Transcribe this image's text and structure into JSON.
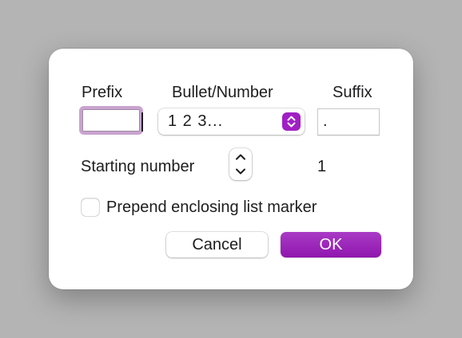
{
  "dialog": {
    "prefix": {
      "label": "Prefix",
      "value": ""
    },
    "bullet_number": {
      "label": "Bullet/Number",
      "selected": "1  2  3..."
    },
    "suffix": {
      "label": "Suffix",
      "value": "."
    },
    "starting_number": {
      "label": "Starting number",
      "value": "1"
    },
    "prepend_checkbox": {
      "label": "Prepend enclosing list marker",
      "checked": false
    },
    "buttons": {
      "cancel": "Cancel",
      "ok": "OK"
    }
  },
  "colors": {
    "accent": "#9b22c0",
    "focus_ring": "#c9a3cf",
    "backdrop": "#b4b4b4",
    "dialog_bg": "#ffffff"
  },
  "icons": {
    "select_indicator": "chevron-up-down-icon",
    "stepper_up": "chevron-up-icon",
    "stepper_down": "chevron-down-icon"
  }
}
